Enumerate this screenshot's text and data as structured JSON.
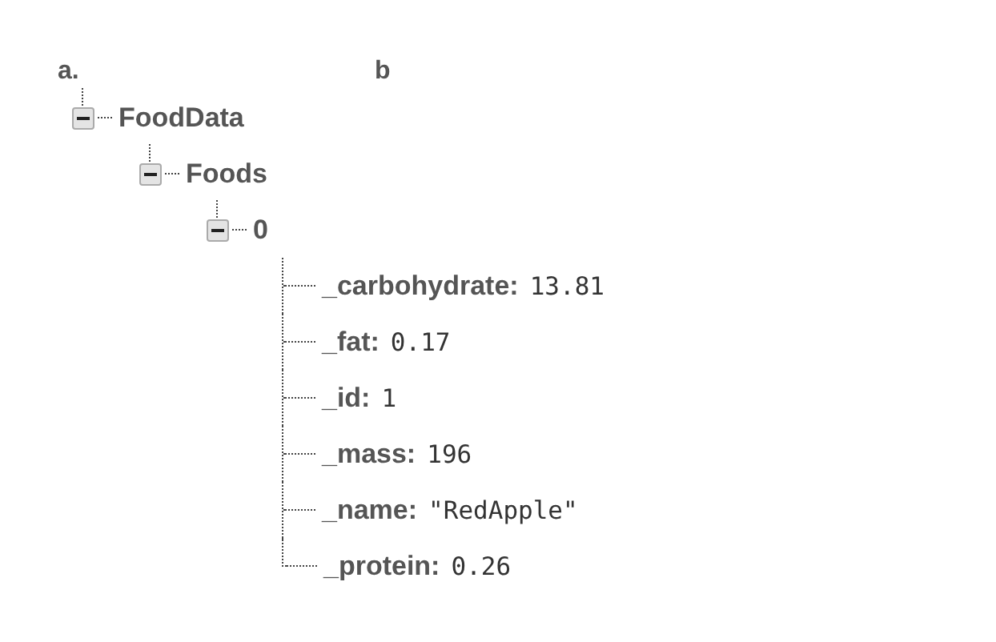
{
  "labels": [
    "a.",
    "b"
  ],
  "tree": [
    {
      "kind": "node",
      "label": "FoodData",
      "expanded": true,
      "children": [
        {
          "kind": "node",
          "label": "Foods",
          "expanded": true,
          "children": [
            {
              "kind": "node",
              "label": "0",
              "expanded": true,
              "children": [
                {
                  "kind": "leaf",
                  "key": "_carbohydrate:",
                  "value": "13.81"
                },
                {
                  "kind": "leaf",
                  "key": "_fat:",
                  "value": "0.17"
                },
                {
                  "kind": "leaf",
                  "key": "_id:",
                  "value": "1"
                },
                {
                  "kind": "leaf",
                  "key": "_mass:",
                  "value": "196"
                },
                {
                  "kind": "leaf",
                  "key": "_name:",
                  "value": "\"RedApple\""
                },
                {
                  "kind": "leaf",
                  "key": "_protein:",
                  "value": "0.26"
                }
              ]
            }
          ]
        }
      ]
    }
  ]
}
